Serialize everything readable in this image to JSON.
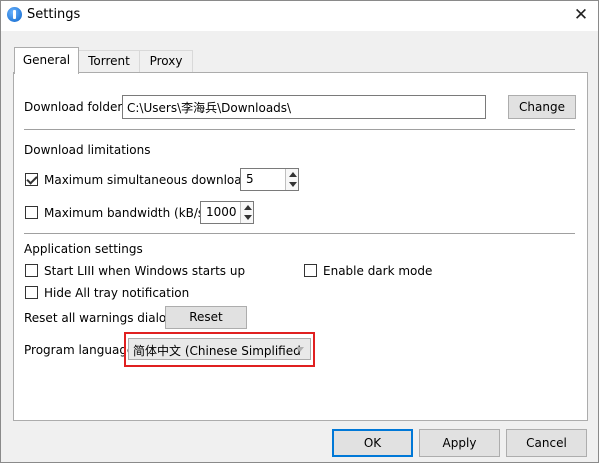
{
  "window": {
    "title": "Settings",
    "close_glyph": "✕"
  },
  "tabs": [
    {
      "label": "General",
      "active": true
    },
    {
      "label": "Torrent",
      "active": false
    },
    {
      "label": "Proxy",
      "active": false
    }
  ],
  "general": {
    "download_folder_label": "Download folder:",
    "download_folder_value": "C:\\Users\\李海兵\\Downloads\\",
    "change_button": "Change",
    "download_limitations_heading": "Download limitations",
    "max_downloads": {
      "label": "Maximum simultaneous downloads",
      "checked": true,
      "value": "5"
    },
    "max_bandwidth": {
      "label": "Maximum bandwidth (kB/s)",
      "checked": false,
      "value": "1000"
    },
    "application_settings_heading": "Application settings",
    "start_with_windows": {
      "label": "Start LIII when Windows starts up",
      "checked": false
    },
    "dark_mode": {
      "label": "Enable dark mode",
      "checked": false
    },
    "hide_tray": {
      "label": "Hide All tray notification",
      "checked": false
    },
    "reset_warnings_label": "Reset all warnings dialogs",
    "reset_button": "Reset",
    "program_language_label": "Program language",
    "program_language_value": "简体中文 (Chinese Simplified H"
  },
  "footer": {
    "ok": "OK",
    "apply": "Apply",
    "cancel": "Cancel"
  },
  "colors": {
    "highlight": "#e02020",
    "focus": "#0078d7"
  },
  "icons": {
    "app": "app-icon",
    "close": "close-icon",
    "check": "checkmark-icon",
    "dropdown": "chevron-down-icon"
  }
}
